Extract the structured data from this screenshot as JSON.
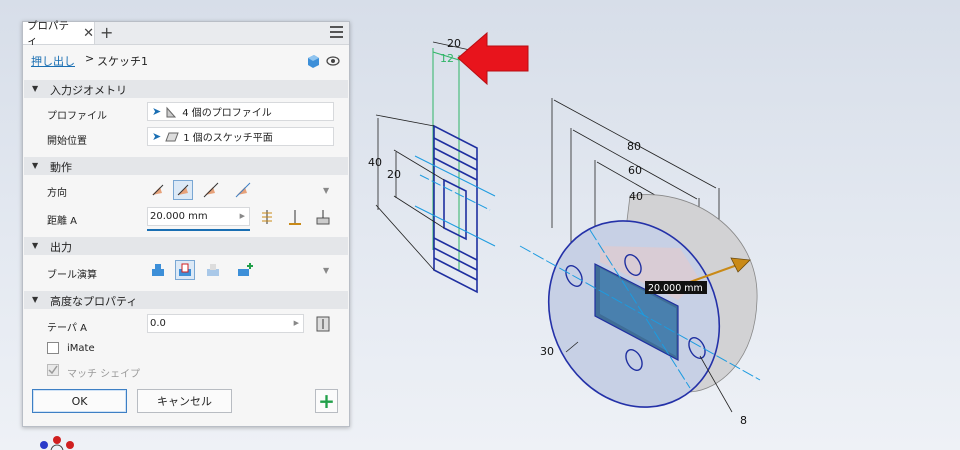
{
  "panel": {
    "tab_label": "プロパティ",
    "breadcrumb": {
      "link": "押し出し",
      "separator": ">",
      "current": "スケッチ1"
    },
    "sections": {
      "input_geometry": "入力ジオメトリ",
      "behavior": "動作",
      "output": "出力",
      "advanced": "高度なプロパティ"
    },
    "fields": {
      "profile_label": "プロファイル",
      "profile_value": "4 個のプロファイル",
      "start_label": "開始位置",
      "start_value": "1 個のスケッチ平面",
      "direction_label": "方向",
      "distance_label": "距離 A",
      "distance_value": "20.000 mm",
      "boolean_label": "ブール演算",
      "taper_label": "テーパ A",
      "taper_value": "0.0"
    },
    "checkboxes": {
      "imate": "iMate",
      "match_shape": "マッチ シェイプ"
    },
    "buttons": {
      "ok": "OK",
      "cancel": "キャンセル",
      "add": "+"
    }
  },
  "sketch": {
    "dim_top_20": "20",
    "dim_top_12": "12",
    "dim_40": "40",
    "dim_20": "20"
  },
  "model": {
    "dim_80": "80",
    "dim_60": "60",
    "dim_40": "40",
    "dim_30": "30",
    "dim_8": "8",
    "distance_tag": "20.000 mm"
  },
  "colors": {
    "accent": "#1a6fb3",
    "arrow": "#e8141c",
    "sketch_blue": "#1f2fa0",
    "green_dim": "#2fb567"
  }
}
